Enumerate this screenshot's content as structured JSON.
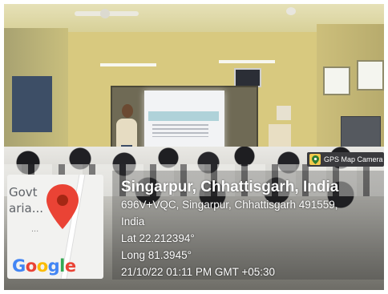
{
  "photo": {
    "description_tag": "classroom-photo"
  },
  "map": {
    "place_label_line1": "Govt",
    "place_label_line2": "aria...",
    "dots": "...",
    "logo_letters": [
      {
        "ch": "G",
        "color": "#4285F4"
      },
      {
        "ch": "o",
        "color": "#EA4335"
      },
      {
        "ch": "o",
        "color": "#FBBC05"
      },
      {
        "ch": "g",
        "color": "#4285F4"
      },
      {
        "ch": "l",
        "color": "#34A853"
      },
      {
        "ch": "e",
        "color": "#EA4335"
      }
    ],
    "pin_color": "#EA4335"
  },
  "gps_badge": {
    "label": "GPS Map Camera",
    "icon": "map-pin-icon"
  },
  "overlay": {
    "title": "Singarpur, Chhattisgarh, India",
    "address_line1": "696V+VQC, Singarpur, Chhattisgarh 491559,",
    "address_line2": "India",
    "lat": "Lat 22.212394°",
    "long": "Long 81.3945°",
    "datetime": "21/10/22 01:11 PM GMT +05:30"
  }
}
